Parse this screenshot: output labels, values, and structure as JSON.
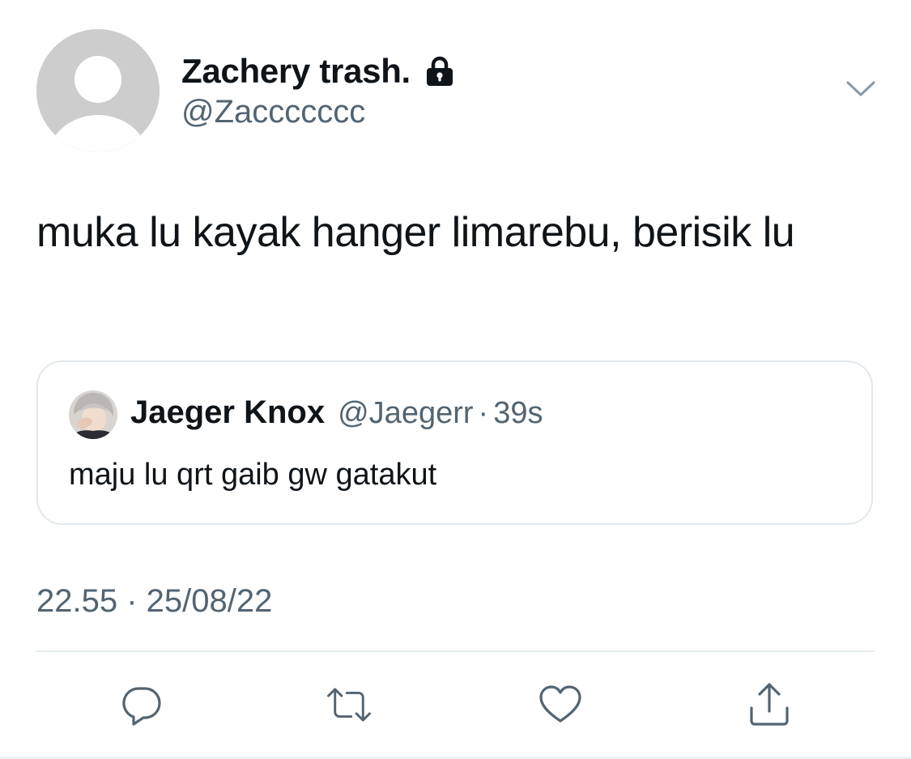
{
  "tweet": {
    "author": {
      "display_name": "Zachery trash.",
      "handle": "@Zaccccccc",
      "protected_icon": "lock-icon"
    },
    "text": "muka lu kayak hanger limarebu, berisik lu",
    "timestamp": "22.55 · 25/08/22",
    "menu_icon": "chevron-down-icon"
  },
  "quoted_tweet": {
    "author": {
      "display_name": "Jaeger Knox",
      "handle": "@Jaegerr"
    },
    "separator": "·",
    "time_ago": "39s",
    "text": "maju lu qrt gaib gw gatakut"
  },
  "actions": [
    {
      "icon": "reply-icon"
    },
    {
      "icon": "retweet-icon"
    },
    {
      "icon": "like-icon"
    },
    {
      "icon": "share-icon"
    }
  ],
  "colors": {
    "primary_text": "#0f1419",
    "secondary_text": "#536471",
    "border": "#e1e8ed",
    "icon": "#536471",
    "avatar_placeholder": "#cdcdcd"
  }
}
